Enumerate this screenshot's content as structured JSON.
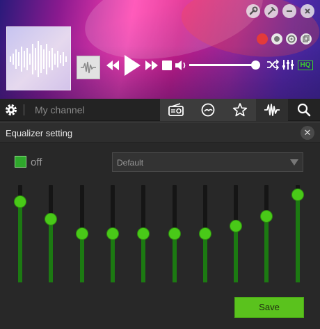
{
  "player": {
    "window_buttons": [
      {
        "icon": "wrench-icon",
        "glyph": "🔧"
      },
      {
        "icon": "pin-icon",
        "glyph": "📌"
      },
      {
        "icon": "minimize-icon",
        "glyph": "–"
      },
      {
        "icon": "close-icon",
        "glyph": "✕"
      }
    ],
    "share_buttons": [
      {
        "icon": "record-icon",
        "color": "#e33a3a"
      },
      {
        "icon": "soccer-icon"
      },
      {
        "icon": "chrome-icon"
      },
      {
        "icon": "copy-icon"
      }
    ],
    "volume": 0.95,
    "hq_label": "HQ",
    "accent_color": "#3ccf2f"
  },
  "nav": {
    "channel_placeholder": "My channel",
    "tabs": [
      {
        "icon": "radio-icon"
      },
      {
        "icon": "heart-hand-icon"
      },
      {
        "icon": "star-icon"
      },
      {
        "icon": "waveform-icon",
        "active": true
      },
      {
        "icon": "search-icon"
      }
    ]
  },
  "equalizer": {
    "title": "Equalizer setting",
    "toggle_label": "off",
    "preset_value": "Default",
    "bands": [
      0.87,
      0.67,
      0.5,
      0.5,
      0.5,
      0.5,
      0.5,
      0.59,
      0.7,
      0.95
    ],
    "save_label": "Save",
    "accent_color": "#49c918"
  }
}
